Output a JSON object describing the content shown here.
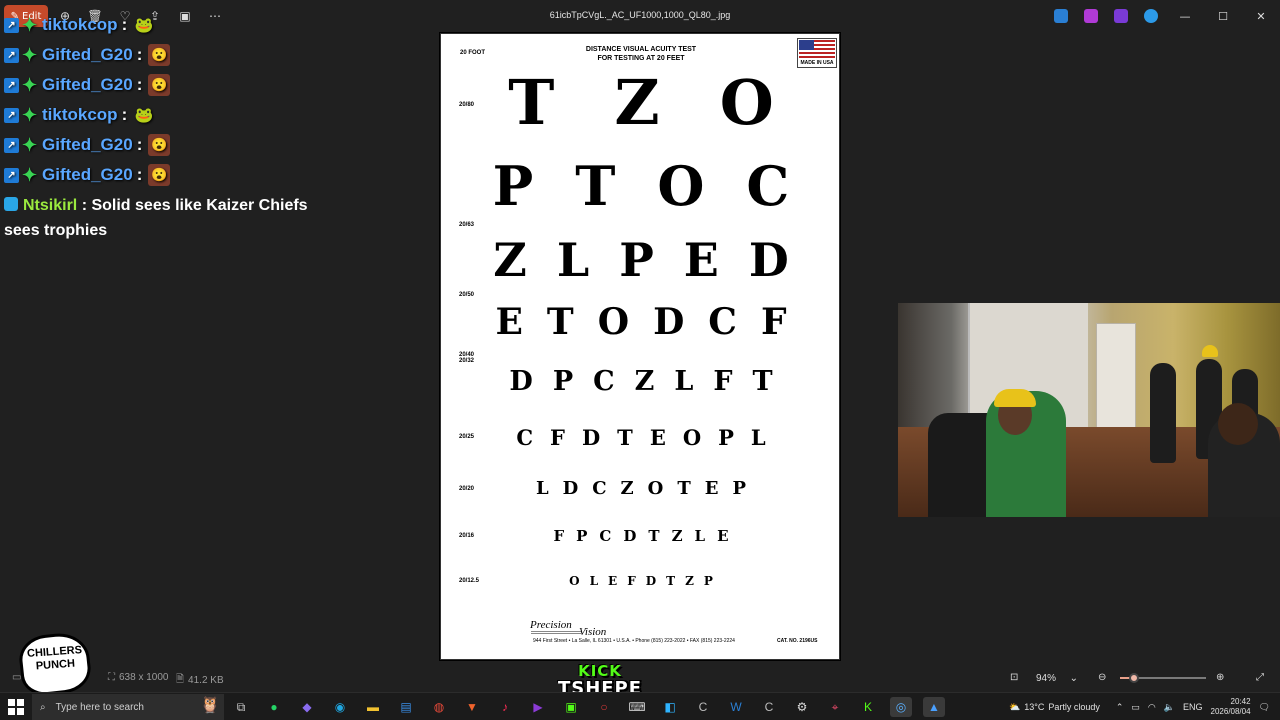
{
  "window": {
    "file_title": "61icbTpCVgL._AC_UF1000,1000_QL80_.jpg",
    "edit_label": "Edit"
  },
  "chat": [
    {
      "user": "tiktokcop",
      "color": "blue",
      "emote": "frog",
      "badges": [
        "kick",
        "gifter"
      ]
    },
    {
      "user": "Gifted_G20",
      "color": "blue",
      "emote": "face",
      "badges": [
        "kick",
        "gifter"
      ]
    },
    {
      "user": "Gifted_G20",
      "color": "blue",
      "emote": "face",
      "badges": [
        "kick",
        "gifter"
      ]
    },
    {
      "user": "tiktokcop",
      "color": "blue",
      "emote": "frog",
      "badges": [
        "kick",
        "gifter"
      ]
    },
    {
      "user": "Gifted_G20",
      "color": "blue",
      "emote": "face",
      "badges": [
        "kick",
        "gifter"
      ]
    },
    {
      "user": "Gifted_G20",
      "color": "blue",
      "emote": "face",
      "badges": [
        "kick",
        "gifter"
      ]
    }
  ],
  "chat_final": {
    "user": "Ntsikirl",
    "message": "Solid sees like Kaizer Chiefs sees trophies"
  },
  "eye_chart": {
    "corner_label": "20 FOOT",
    "title_line1": "DISTANCE VISUAL ACUITY TEST",
    "title_line2": "FOR TESTING AT 20 FEET",
    "flag_label": "MADE IN USA",
    "rows": [
      {
        "letters": "T Z O",
        "acuity": "20/80"
      },
      {
        "letters": "P T O C",
        "acuity": ""
      },
      {
        "letters": "Z L P E D",
        "acuity": "20/63"
      },
      {
        "letters": "E T O D C F",
        "acuity": "20/50"
      },
      {
        "letters": "D P C Z L F T",
        "acuity": "20/40 20/32"
      },
      {
        "letters": "C F D T E O P L",
        "acuity": "20/25"
      },
      {
        "letters": "L D C Z O T E P",
        "acuity": "20/20"
      },
      {
        "letters": "F P C D T Z L E",
        "acuity": "20/16"
      },
      {
        "letters": "O L E F D T Z P",
        "acuity": "20/12.5"
      }
    ],
    "brand_precision": "Precision",
    "brand_vision": "Vision",
    "address": "944 First Street • La Salle, IL 61301 • U.S.A. • Phone (815) 223-2022 • FAX (815) 223-2224",
    "catalog": "CAT. NO. 2196US"
  },
  "viewer_bar": {
    "dimensions": "638 x 1000",
    "file_size": "41.2 KB",
    "zoom": "94%",
    "zoom_level": 0.16
  },
  "logos": {
    "chillers_line1": "CHILLERS",
    "chillers_line2": "PUNCH",
    "kick_line1": "KICK",
    "kick_line2": "TSHEPE"
  },
  "taskbar": {
    "search_placeholder": "Type here to search",
    "weather_temp": "13°C",
    "weather_desc": "Partly cloudy",
    "language": "ENG",
    "time": "20:42",
    "date": "2026/08/04"
  }
}
